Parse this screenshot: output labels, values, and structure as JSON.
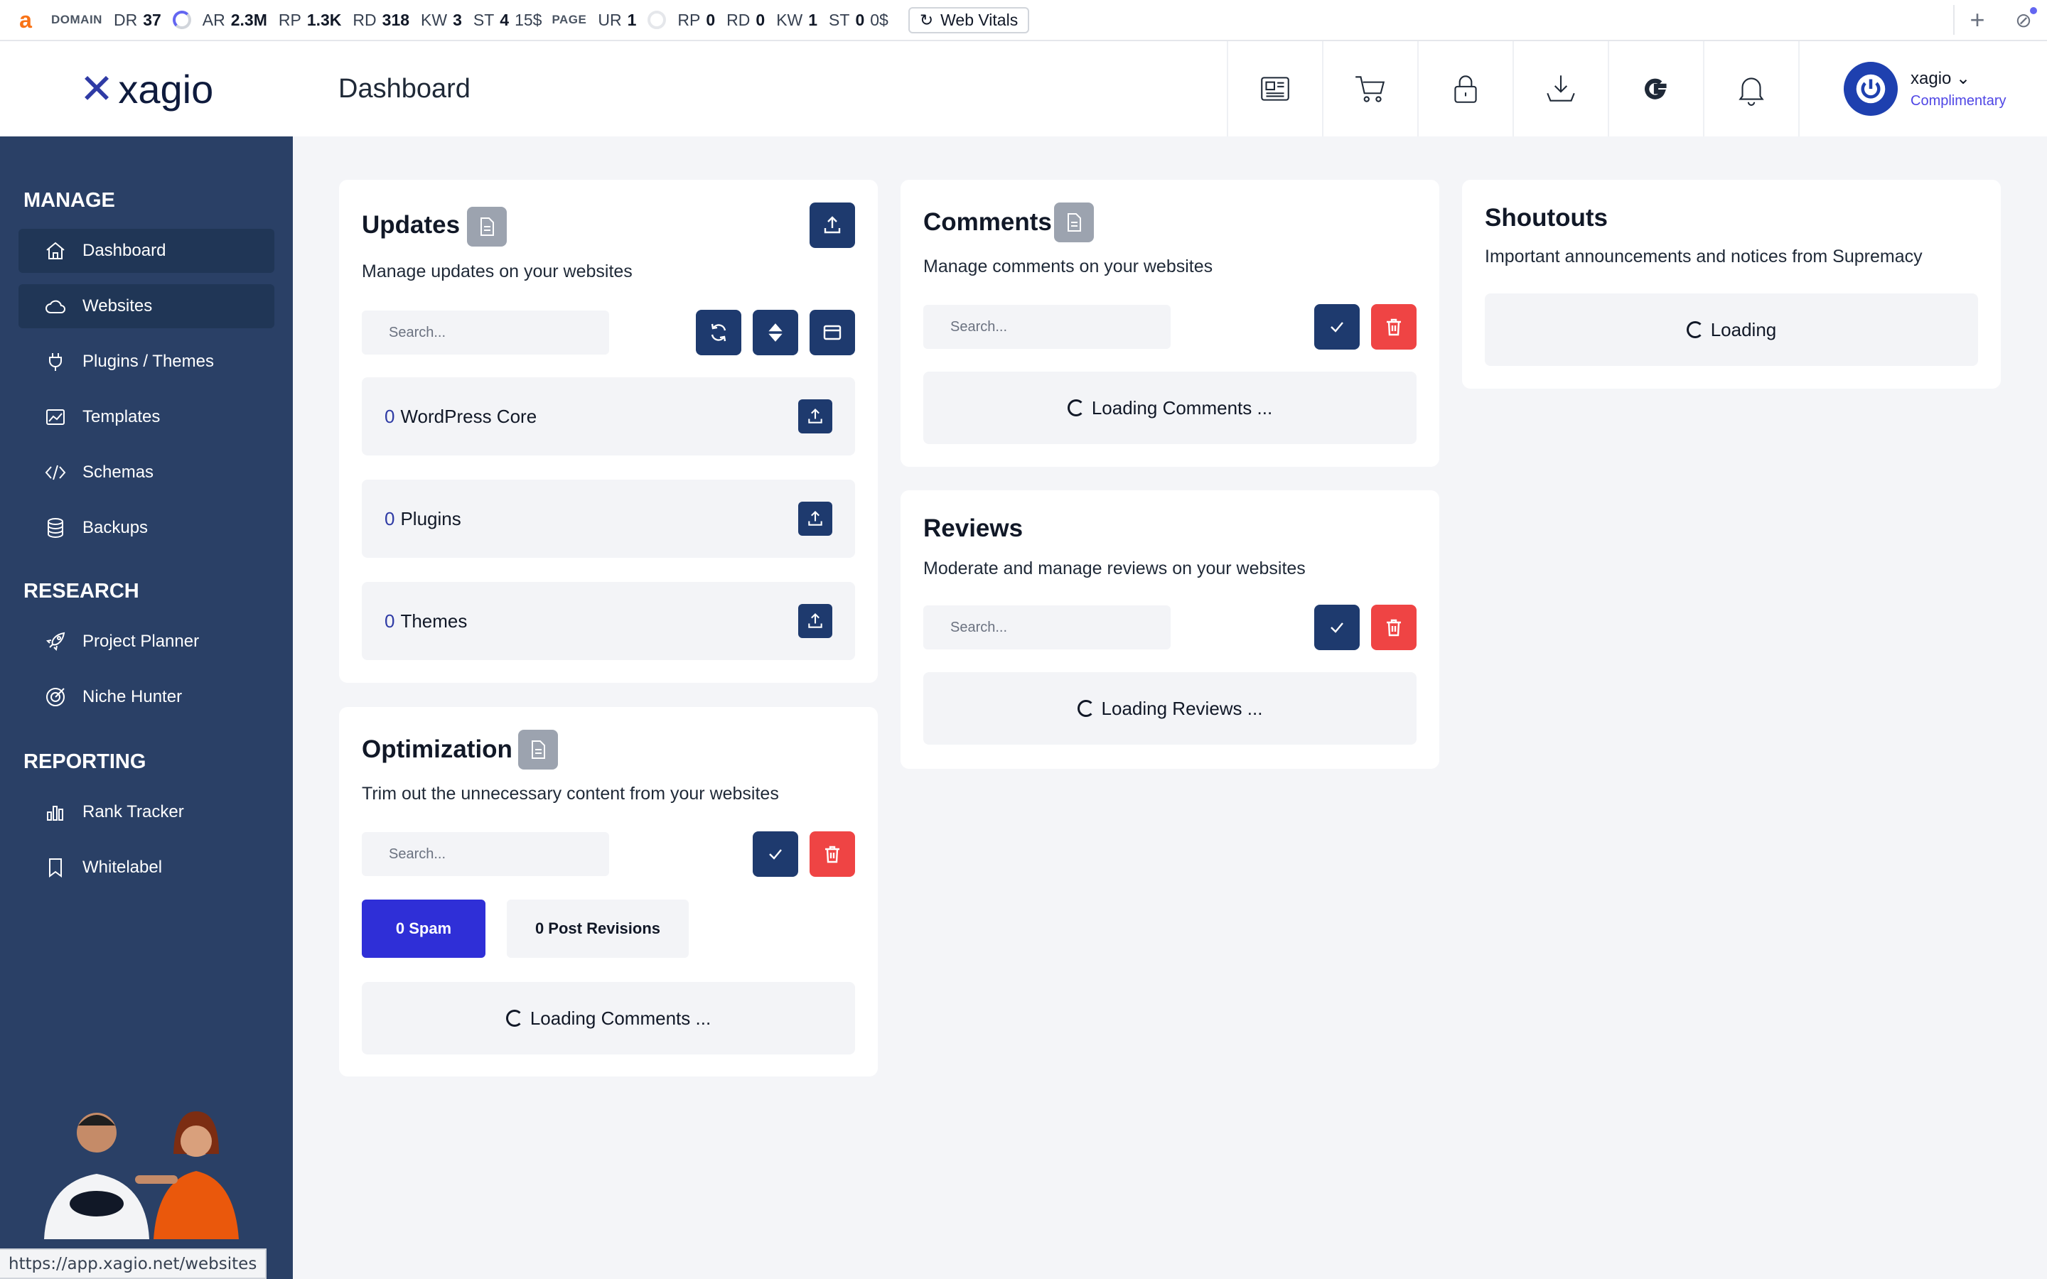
{
  "toolbar": {
    "logo": "a",
    "domain_label": "DOMAIN",
    "domain_metrics": [
      {
        "k": "DR",
        "v": "37"
      },
      {
        "k": "AR",
        "v": "2.3M"
      },
      {
        "k": "RP",
        "v": "1.3K"
      },
      {
        "k": "RD",
        "v": "318"
      },
      {
        "k": "KW",
        "v": "3"
      },
      {
        "k": "ST",
        "v": "4",
        "extra": "15$"
      }
    ],
    "page_label": "PAGE",
    "page_metrics": [
      {
        "k": "UR",
        "v": "1"
      },
      {
        "k": "RP",
        "v": "0"
      },
      {
        "k": "RD",
        "v": "0"
      },
      {
        "k": "KW",
        "v": "1"
      },
      {
        "k": "ST",
        "v": "0",
        "extra": "0$"
      }
    ],
    "web_vitals": "Web Vitals",
    "plus": "+"
  },
  "header": {
    "logo_mark": "✕",
    "logo_text": "xagio",
    "title": "Dashboard",
    "user": {
      "name": "xagio",
      "plan": "Complimentary"
    }
  },
  "sidebar": {
    "sections": [
      {
        "label": "MANAGE",
        "items": [
          "Dashboard",
          "Websites",
          "Plugins / Themes",
          "Templates",
          "Schemas",
          "Backups"
        ]
      },
      {
        "label": "RESEARCH",
        "items": [
          "Project Planner",
          "Niche Hunter"
        ]
      },
      {
        "label": "REPORTING",
        "items": [
          "Rank Tracker",
          "Whitelabel"
        ]
      }
    ]
  },
  "status_url": "https://app.xagio.net/websites",
  "updates": {
    "title": "Updates",
    "desc": "Manage updates on your websites",
    "search_placeholder": "Search...",
    "rows": [
      {
        "count": "0",
        "label": "WordPress Core"
      },
      {
        "count": "0",
        "label": "Plugins"
      },
      {
        "count": "0",
        "label": "Themes"
      }
    ]
  },
  "optimization": {
    "title": "Optimization",
    "desc": "Trim out the unnecessary content from your websites",
    "search_placeholder": "Search...",
    "spam": "0 Spam",
    "revisions": "0 Post Revisions",
    "loading": "Loading Comments ..."
  },
  "comments": {
    "title": "Comments",
    "desc": "Manage comments on your websites",
    "search_placeholder": "Search...",
    "loading": "Loading Comments ..."
  },
  "reviews": {
    "title": "Reviews",
    "desc": "Moderate and manage reviews on your websites",
    "search_placeholder": "Search...",
    "loading": "Loading Reviews ..."
  },
  "shoutouts": {
    "title": "Shoutouts",
    "desc": "Important announcements and notices from Supremacy",
    "loading": "Loading"
  }
}
